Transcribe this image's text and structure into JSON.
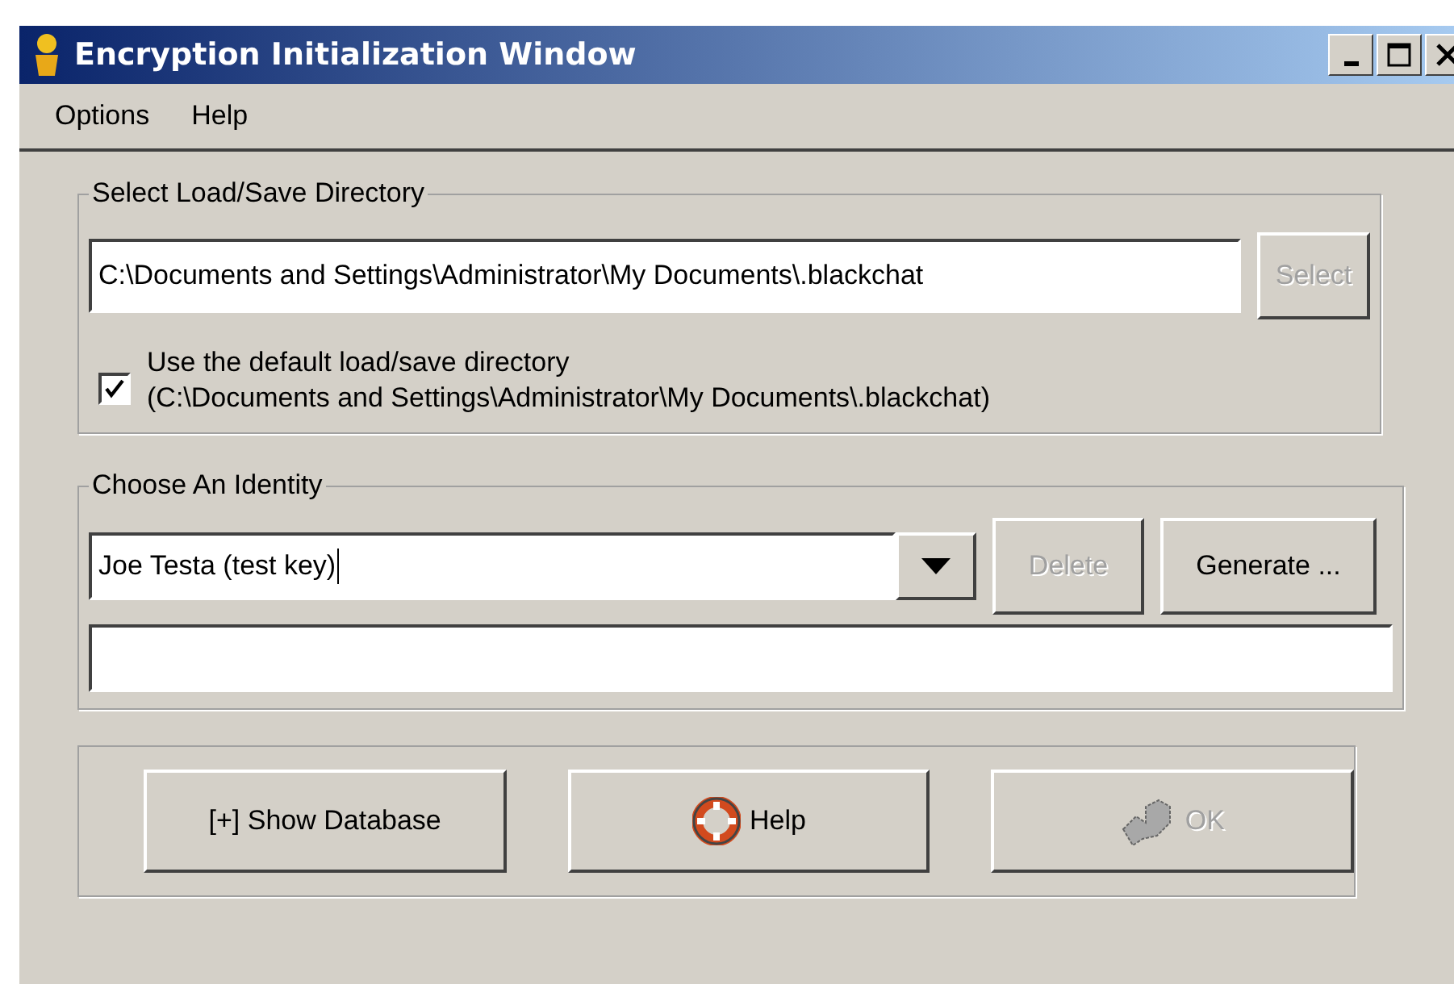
{
  "window": {
    "title": "Encryption Initialization Window"
  },
  "menu": [
    {
      "label": "Options"
    },
    {
      "label": "Help"
    }
  ],
  "directory_group": {
    "title": "Select Load/Save Directory",
    "path": "C:\\Documents and Settings\\Administrator\\My Documents\\.blackchat",
    "select_button": {
      "label": "Select",
      "disabled": true
    },
    "use_default": {
      "checked": true,
      "label_line_1": "Use the default load/save directory",
      "label_line_2": "(C:\\Documents and Settings\\Administrator\\My Documents\\.blackchat)"
    }
  },
  "identity_group": {
    "title": "Choose An Identity",
    "identity": "Joe Testa (test key)",
    "delete_button": {
      "label": "Delete",
      "disabled": true
    },
    "generate_button": {
      "label": "Generate ...",
      "disabled": false
    }
  },
  "buttons": [
    {
      "kind": "plain",
      "label": "[+] Show Database",
      "disabled": false
    },
    {
      "kind": "help",
      "label": "Help",
      "disabled": false
    },
    {
      "kind": "ok",
      "label": "OK",
      "disabled": true
    }
  ]
}
